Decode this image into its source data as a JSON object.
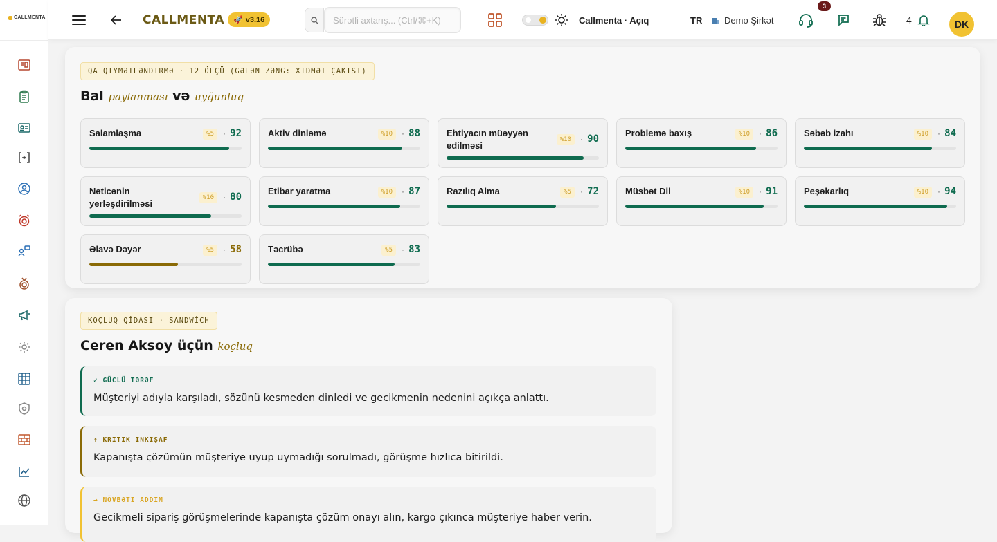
{
  "brand": {
    "name": "CALLMENTA"
  },
  "header": {
    "title": "CALLMENTA",
    "version": "v3.16",
    "search_placeholder": "Sürətli axtarış... (Ctrl/⌘+K)",
    "theme_label": "Callmenta · Açıq",
    "language": "TR",
    "company": "Demo Şirkət",
    "support_badge": "3",
    "notification_count": "4",
    "avatar_initials": "DK"
  },
  "sidebar": {
    "items": [
      {
        "icon": "dashboard-icon"
      },
      {
        "icon": "clipboard-icon"
      },
      {
        "icon": "id-card-icon"
      },
      {
        "icon": "code-brackets-icon"
      },
      {
        "icon": "user-circle-icon"
      },
      {
        "icon": "alarm-icon"
      },
      {
        "icon": "user-chat-icon"
      },
      {
        "icon": "medal-icon"
      },
      {
        "icon": "megaphone-icon"
      },
      {
        "icon": "gear-icon"
      },
      {
        "icon": "grid-board-icon"
      },
      {
        "icon": "shield-icon"
      },
      {
        "icon": "bricks-icon"
      },
      {
        "icon": "line-chart-icon"
      },
      {
        "icon": "globe-icon"
      }
    ]
  },
  "qa": {
    "eyebrow": "QA QIYMƏTLƏNDIRMƏ · 12 ÖLÇÜ (GƏLƏN ZƏNG: XIDMƏT ÇAKISI)",
    "heading_main": "Bal",
    "heading_accent_1": "paylanması",
    "heading_mid": "və",
    "heading_accent_2": "uyğunluq",
    "metrics": [
      {
        "name": "Salamlaşma",
        "weight": "%5",
        "score": "92",
        "value": 92
      },
      {
        "name": "Aktiv dinləmə",
        "weight": "%10",
        "score": "88",
        "value": 88
      },
      {
        "name": "Ehtiyacın müəyyən edilməsi",
        "weight": "%10",
        "score": "90",
        "value": 90
      },
      {
        "name": "Problemə baxış",
        "weight": "%10",
        "score": "86",
        "value": 86
      },
      {
        "name": "Səbəb izahı",
        "weight": "%10",
        "score": "84",
        "value": 84
      },
      {
        "name": "Nəticənin yerləşdirilməsi",
        "weight": "%10",
        "score": "80",
        "value": 80
      },
      {
        "name": "Etibar yaratma",
        "weight": "%10",
        "score": "87",
        "value": 87
      },
      {
        "name": "Razılıq Alma",
        "weight": "%5",
        "score": "72",
        "value": 72
      },
      {
        "name": "Müsbət Dil",
        "weight": "%10",
        "score": "91",
        "value": 91
      },
      {
        "name": "Peşəkarlıq",
        "weight": "%10",
        "score": "94",
        "value": 94
      },
      {
        "name": "Əlavə Dəyər",
        "weight": "%5",
        "score": "58",
        "value": 58
      },
      {
        "name": "Təcrübə",
        "weight": "%5",
        "score": "83",
        "value": 83
      }
    ]
  },
  "coaching": {
    "eyebrow": "KOÇLUQ QİDASI · SANDWİCH",
    "heading_main": "Ceren Aksoy üçün",
    "heading_accent": "koçluq",
    "notes": [
      {
        "tag": "✓ GÜCLÜ TƏRƏF",
        "text": "Müşteriyi adıyla karşıladı, sözünü kesmeden dinledi ve gecikmenin nedenini açıkça anlattı."
      },
      {
        "tag": "↑ KRITIK INKIŞAF",
        "text": "Kapanışta çözümün müşteriye uyup uymadığı sorulmadı, görüşme hızlıca bitirildi."
      },
      {
        "tag": "→ NÖVBƏTI ADDIM",
        "text": "Gecikmeli sipariş görüşmelerinde kapanışta çözüm onayı alın, kargo çıkınca müşteriye haber verin."
      }
    ]
  },
  "colors": {
    "accent_gold": "#f1c232",
    "primary_green": "#0f6b4f",
    "warn_olive": "#8a6a06"
  }
}
